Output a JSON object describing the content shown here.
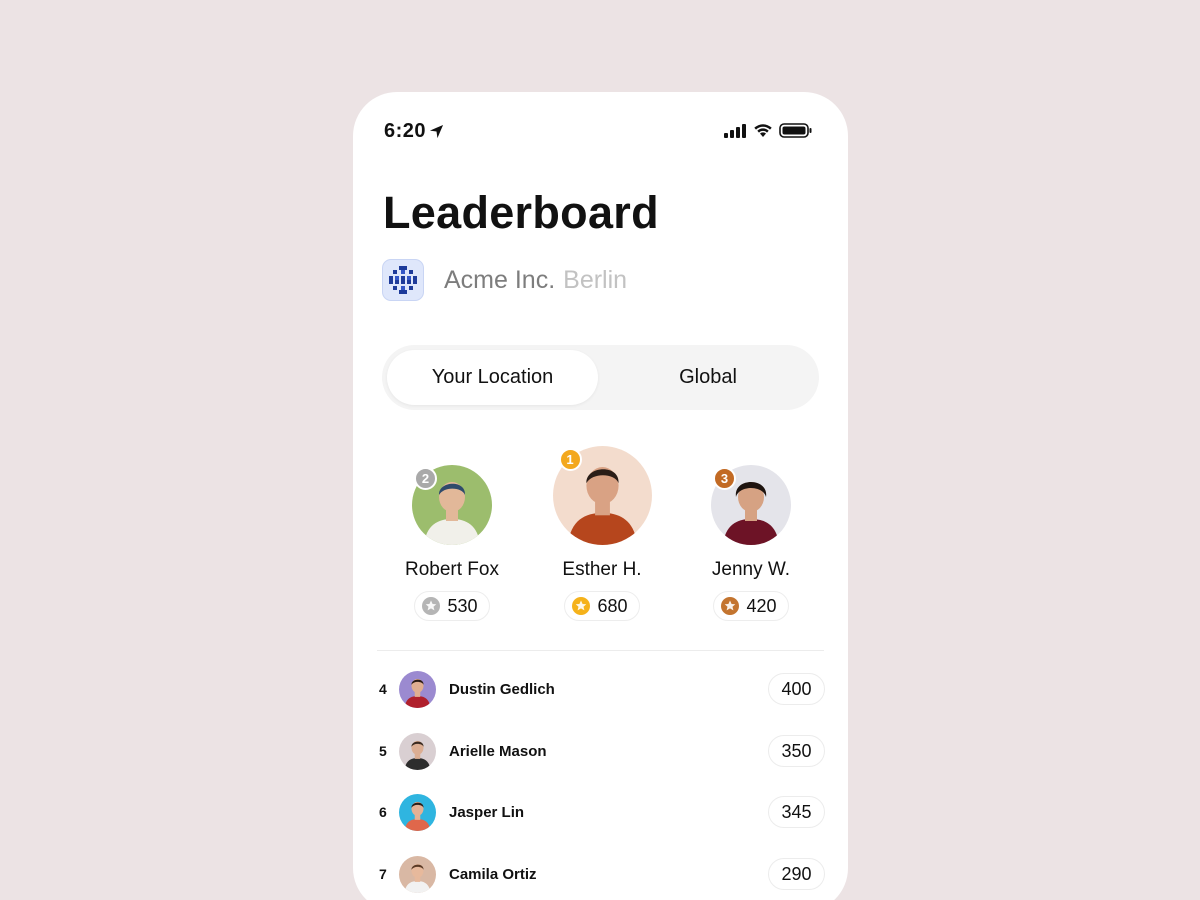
{
  "status_bar": {
    "time": "6:20",
    "icons": [
      "location-arrow-icon",
      "cellular-signal-icon",
      "wifi-icon",
      "battery-icon"
    ]
  },
  "header": {
    "title": "Leaderboard",
    "company_name": "Acme Inc.",
    "company_city": "Berlin"
  },
  "tabs": [
    {
      "label": "Your Location",
      "active": true
    },
    {
      "label": "Global",
      "active": false
    }
  ],
  "podium": [
    {
      "rank": "2",
      "name": "Robert Fox",
      "points": "530",
      "badge_color": "#a9a9a9",
      "medal_color": "#b5b5b5",
      "avatar_bg": "#9cbd6d",
      "shirt": "#f1f0ea",
      "skin": "#e2b899",
      "hair": "#2f4b6b"
    },
    {
      "rank": "1",
      "name": "Esther H.",
      "points": "680",
      "badge_color": "#f3a81e",
      "medal_color": "#f5b21a",
      "avatar_bg": "#f3dccd",
      "shirt": "#b6461d",
      "skin": "#d9a284",
      "hair": "#2a1d17"
    },
    {
      "rank": "3",
      "name": "Jenny W.",
      "points": "420",
      "badge_color": "#c26a24",
      "medal_color": "#c3742f",
      "avatar_bg": "#e4e4ea",
      "shirt": "#6d1326",
      "skin": "#d6a283",
      "hair": "#1e1410"
    }
  ],
  "list": [
    {
      "rank": "4",
      "name": "Dustin Gedlich",
      "score": "400",
      "avatar_bg": "#9b8ad0",
      "shirt": "#b0202c",
      "skin": "#e0ae91",
      "hair": "#2b1b14"
    },
    {
      "rank": "5",
      "name": "Arielle Mason",
      "score": "350",
      "avatar_bg": "#d9cfd2",
      "shirt": "#2d2d2d",
      "skin": "#dcae93",
      "hair": "#3a2a20"
    },
    {
      "rank": "6",
      "name": "Jasper Lin",
      "score": "345",
      "avatar_bg": "#2fb5e0",
      "shirt": "#e0674b",
      "skin": "#e3b195",
      "hair": "#2a1e18"
    },
    {
      "rank": "7",
      "name": "Camila Ortiz",
      "score": "290",
      "avatar_bg": "#d9b8a4",
      "shirt": "#f2f2f2",
      "skin": "#e7b99c",
      "hair": "#5a3a26"
    }
  ]
}
